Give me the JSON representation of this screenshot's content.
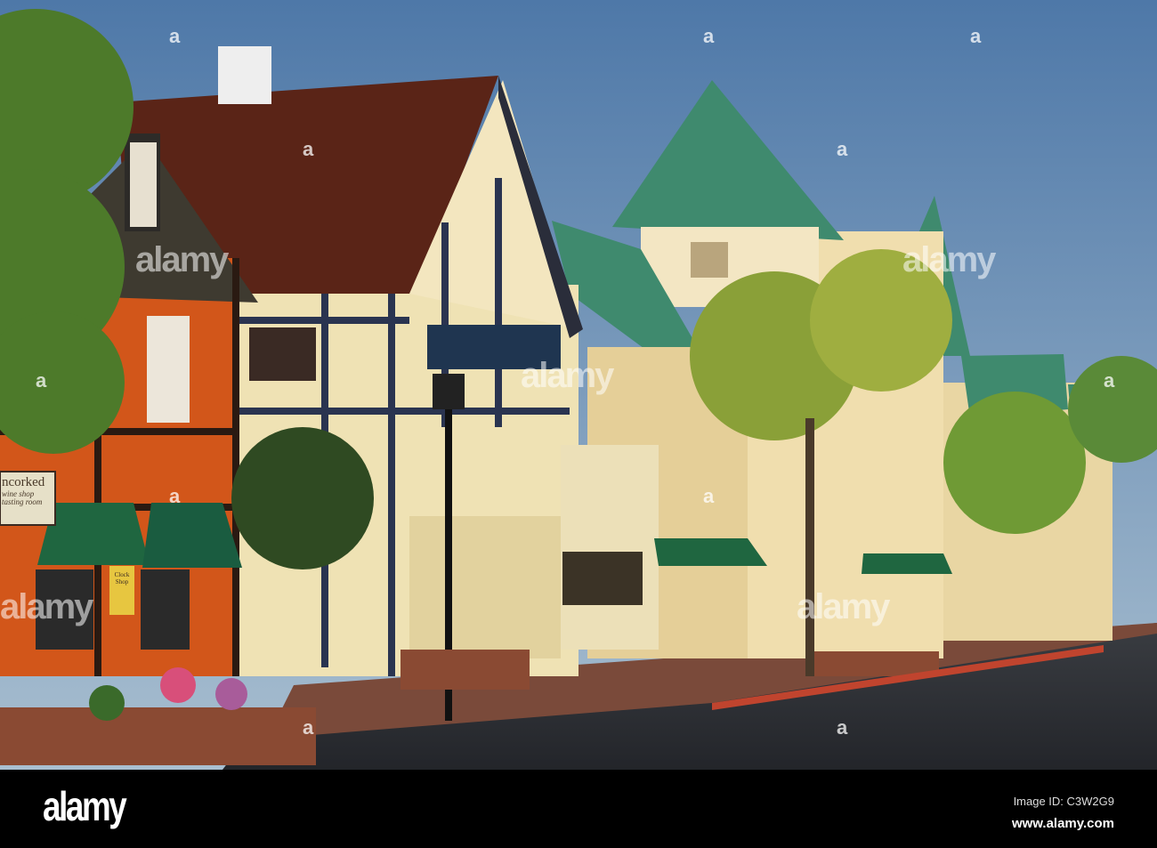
{
  "photo": {
    "description_label": "Street scene",
    "signs": {
      "wine_shop_name": "ncorked",
      "wine_shop_line1": "wine shop",
      "wine_shop_line2": "tasting room",
      "clock_shop": "Clock Shop"
    },
    "watermark": "alamy",
    "watermark_letter": "a"
  },
  "footer": {
    "logo": "alamy",
    "image_id": "Image ID: C3W2G9",
    "website": "www.alamy.com"
  },
  "colors": {
    "sky_top": "#4e78a8",
    "sky_bottom": "#a9bfd0",
    "roof_green": "#3f8a6e",
    "roof_red": "#5a2417",
    "orange_wall": "#d2561a"
  }
}
